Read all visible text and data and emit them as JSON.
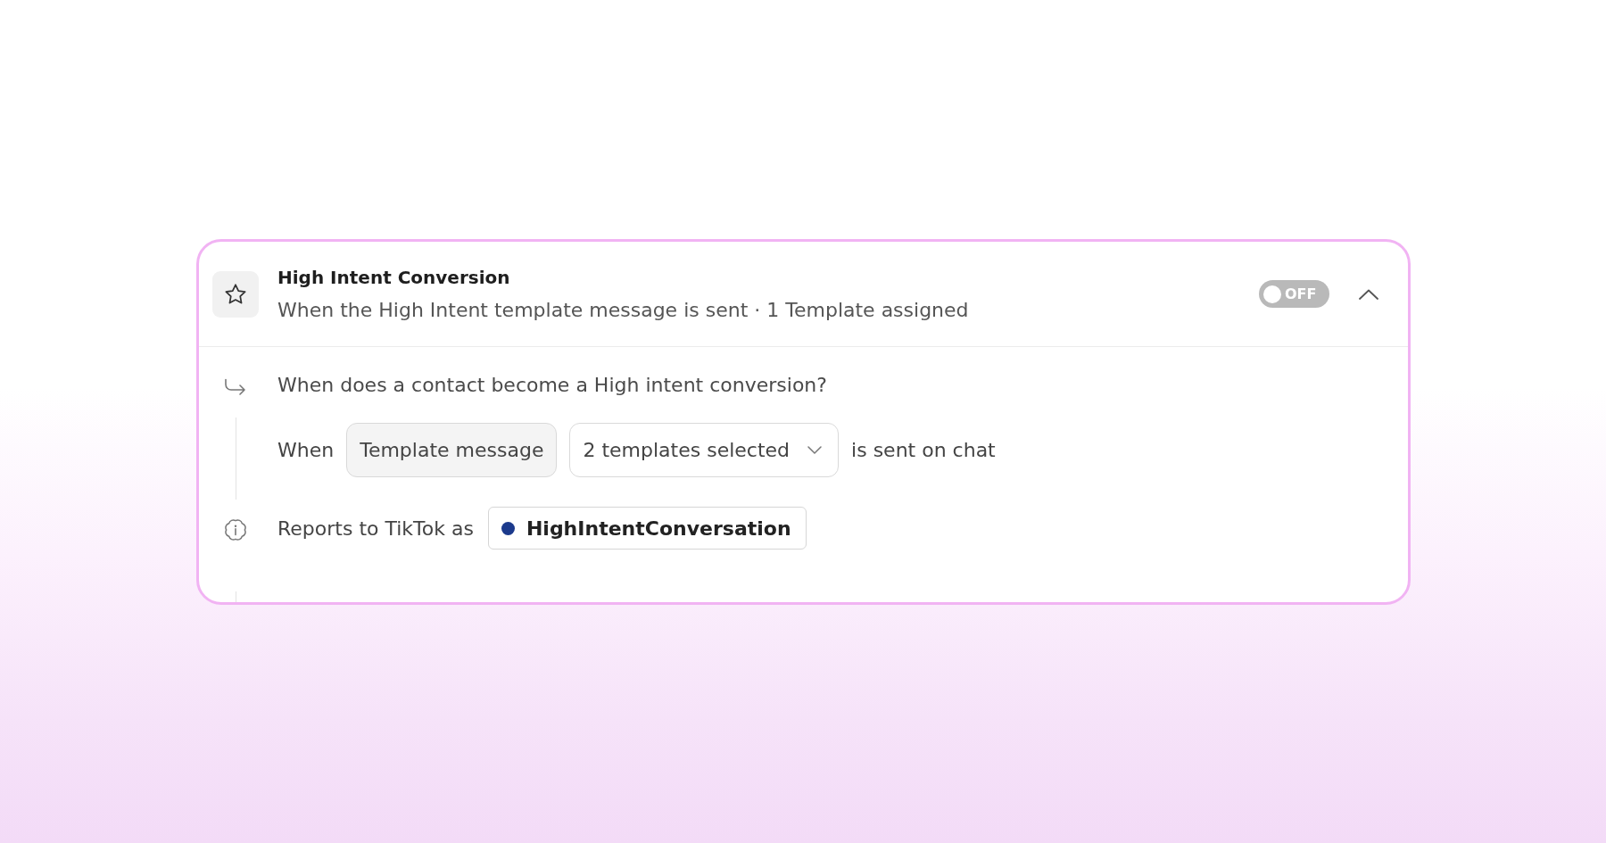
{
  "rule": {
    "title": "High Intent Conversion",
    "subtitle": "When the High Intent template message is sent · 1 Template assigned",
    "toggle": {
      "label": "OFF",
      "on": false
    },
    "expanded": true
  },
  "trigger": {
    "question": "When does a contact become a High intent conversion?",
    "condition": [
      {
        "kind": "text",
        "text": "When"
      },
      {
        "kind": "pill",
        "text": "Template message"
      },
      {
        "kind": "dropdown",
        "value": "2 templates selected"
      },
      {
        "kind": "text",
        "text": "is sent on chat"
      }
    ]
  },
  "report": {
    "label": "Reports to TikTok as",
    "event": "HighIntentConversation"
  }
}
